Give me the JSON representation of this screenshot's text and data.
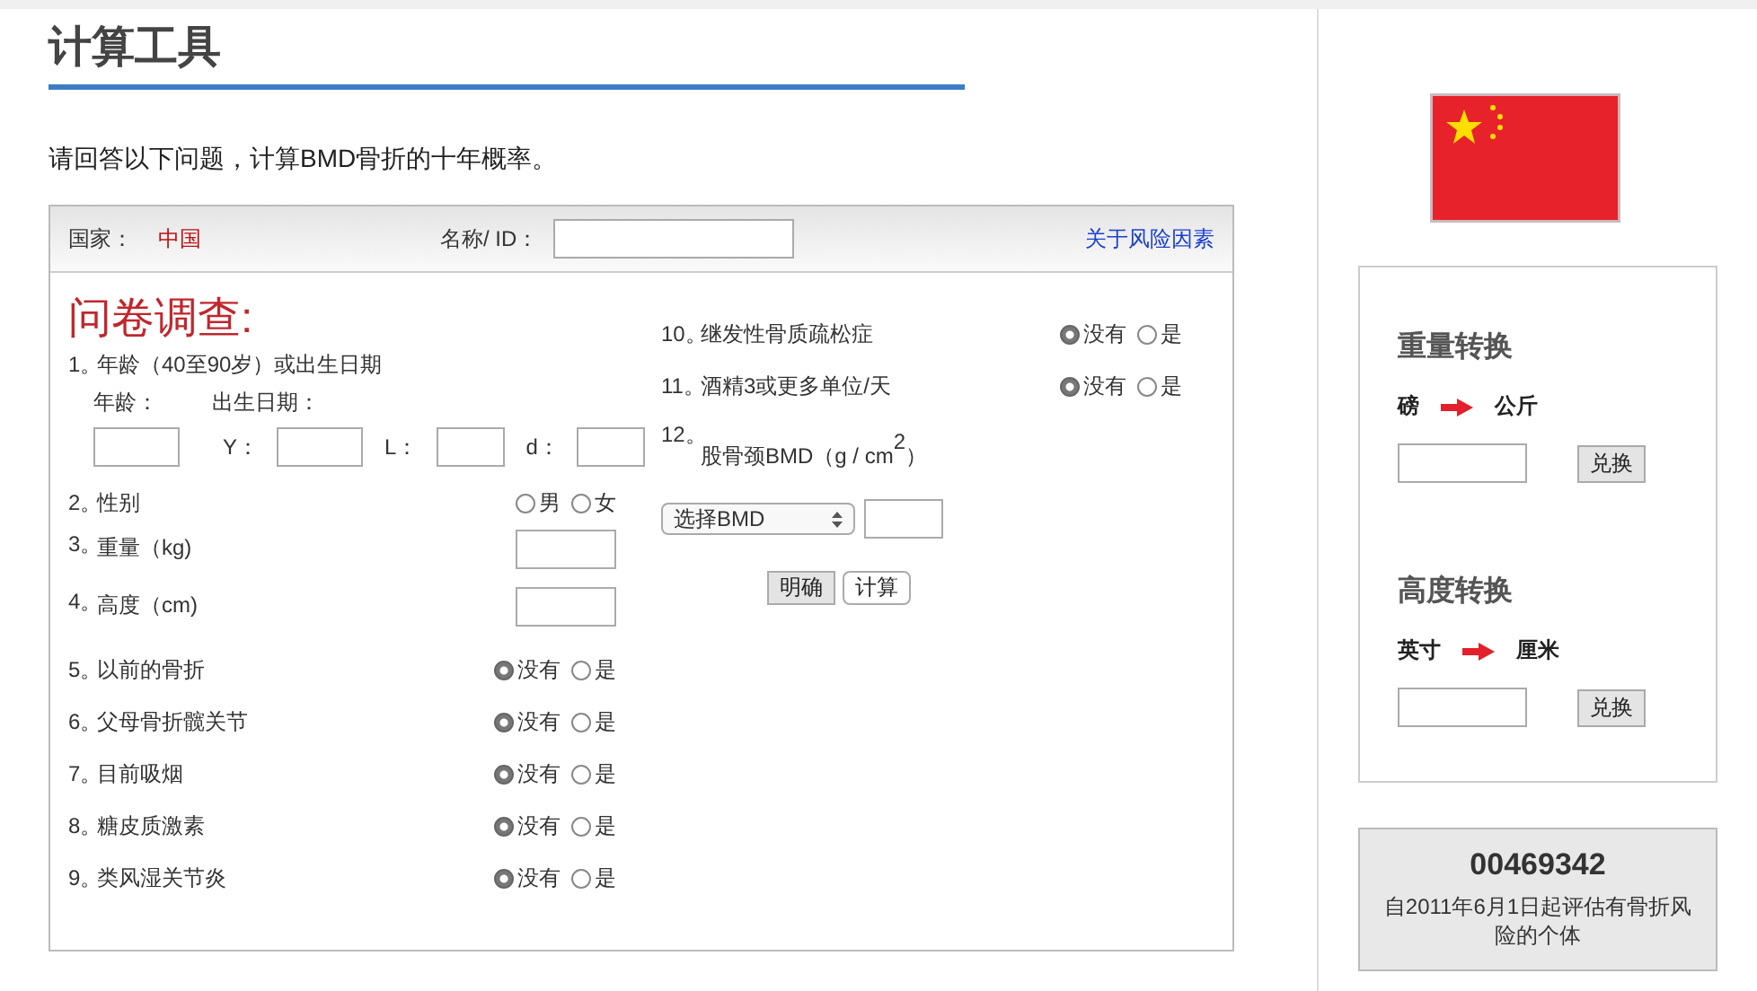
{
  "title": "计算工具",
  "intro": "请回答以下问题，计算BMD骨折的十年概率。",
  "form": {
    "country_label": "国家：",
    "country": "中国",
    "name_label": "名称/ ID：",
    "risk_link": "关于风险因素",
    "heading": "问卷调查:",
    "questions_left": [
      {
        "number": "1。",
        "label": "年龄（40至90岁）或出生日期",
        "kind": "date",
        "age_label": "年龄：",
        "dob_label": "出生日期：",
        "date_parts": [
          "Y：",
          "L：",
          "d："
        ]
      },
      {
        "number": "2。",
        "label": "性别",
        "kind": "radio",
        "options": [
          {
            "label": "男",
            "selected": false
          },
          {
            "label": "女",
            "selected": false
          }
        ]
      },
      {
        "number": "3。",
        "label": "重量（kg)",
        "kind": "input"
      },
      {
        "number": "4。",
        "label": "高度（cm)",
        "kind": "input"
      },
      {
        "number": "5。",
        "label": "以前的骨折",
        "kind": "radio",
        "options": [
          {
            "label": "没有",
            "selected": true
          },
          {
            "label": "是",
            "selected": false
          }
        ]
      },
      {
        "number": "6。",
        "label": "父母骨折髋关节",
        "kind": "radio",
        "options": [
          {
            "label": "没有",
            "selected": true
          },
          {
            "label": "是",
            "selected": false
          }
        ]
      },
      {
        "number": "7。",
        "label": "目前吸烟",
        "kind": "radio",
        "options": [
          {
            "label": "没有",
            "selected": true
          },
          {
            "label": "是",
            "selected": false
          }
        ]
      },
      {
        "number": "8。",
        "label": "糖皮质激素",
        "kind": "radio",
        "options": [
          {
            "label": "没有",
            "selected": true
          },
          {
            "label": "是",
            "selected": false
          }
        ]
      },
      {
        "number": "9。",
        "label": "类风湿关节炎",
        "kind": "radio",
        "options": [
          {
            "label": "没有",
            "selected": true
          },
          {
            "label": "是",
            "selected": false
          }
        ]
      }
    ],
    "questions_right": [
      {
        "number": "10。",
        "label": "继发性骨质疏松症",
        "kind": "radio",
        "options": [
          {
            "label": "没有",
            "selected": true
          },
          {
            "label": "是",
            "selected": false
          }
        ]
      },
      {
        "number": "11。",
        "label": "酒精3或更多单位/天",
        "kind": "radio",
        "options": [
          {
            "label": "没有",
            "selected": true
          },
          {
            "label": "是",
            "selected": false
          }
        ]
      },
      {
        "number": "12。",
        "label": "股骨颈BMD（g / cm$^{2}$）",
        "kind": "bmd",
        "select": "选择BMD"
      }
    ],
    "buttons": [
      {
        "label": "明确",
        "kind": "default"
      },
      {
        "label": "计算",
        "kind": "plain"
      }
    ]
  },
  "converters": [
    {
      "title": "重量转换",
      "from": "磅",
      "to": "公斤",
      "button": "兑换"
    },
    {
      "title": "高度转换",
      "from": "英寸",
      "to": "厘米",
      "button": "兑换"
    }
  ],
  "counter": {
    "number": "00469342",
    "caption": "自2011年6月1日起评估有骨折风险的个体"
  }
}
